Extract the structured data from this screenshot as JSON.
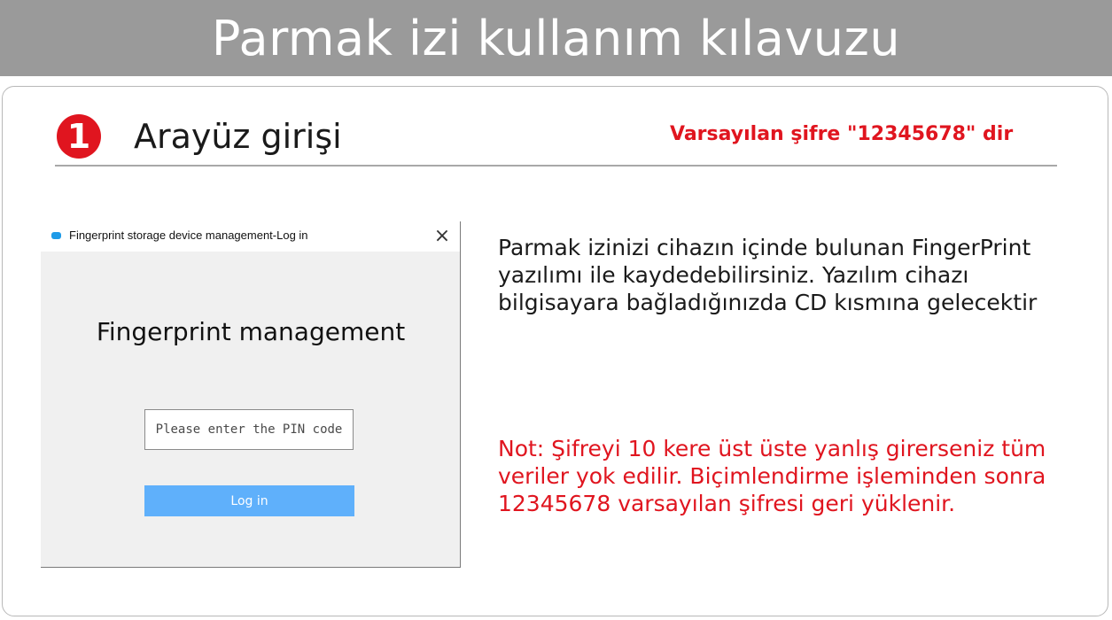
{
  "banner": {
    "title": "Parmak izi kullanım kılavuzu"
  },
  "step": {
    "number": "1",
    "title": "Arayüz girişi",
    "default_password_note": "Varsayılan şifre \"12345678\" dir"
  },
  "login_window": {
    "title": "Fingerprint storage device management-Log in",
    "close_glyph": "×",
    "heading": "Fingerprint management",
    "pin_placeholder": "Please enter the PIN code",
    "login_label": "Log in"
  },
  "description": "Parmak izinizi cihazın içinde bulunan FingerPrint yazılımı ile kaydedebilirsiniz. Yazılım cihazı bilgisayara bağladığınızda CD kısmına gelecektir",
  "note": "Not: Şifreyi 10 kere üst üste yanlış girerseniz tüm veriler yok edilir. Biçimlendirme işleminden sonra 12345678 varsayılan şifresi geri yüklenir.",
  "colors": {
    "banner_bg": "#9a9a9a",
    "accent_red": "#e0151f",
    "login_button": "#5fb0fb",
    "window_bg": "#f0f0f0"
  },
  "icons": {
    "app_icon": "fingerprint-app-icon",
    "close": "close-icon"
  }
}
